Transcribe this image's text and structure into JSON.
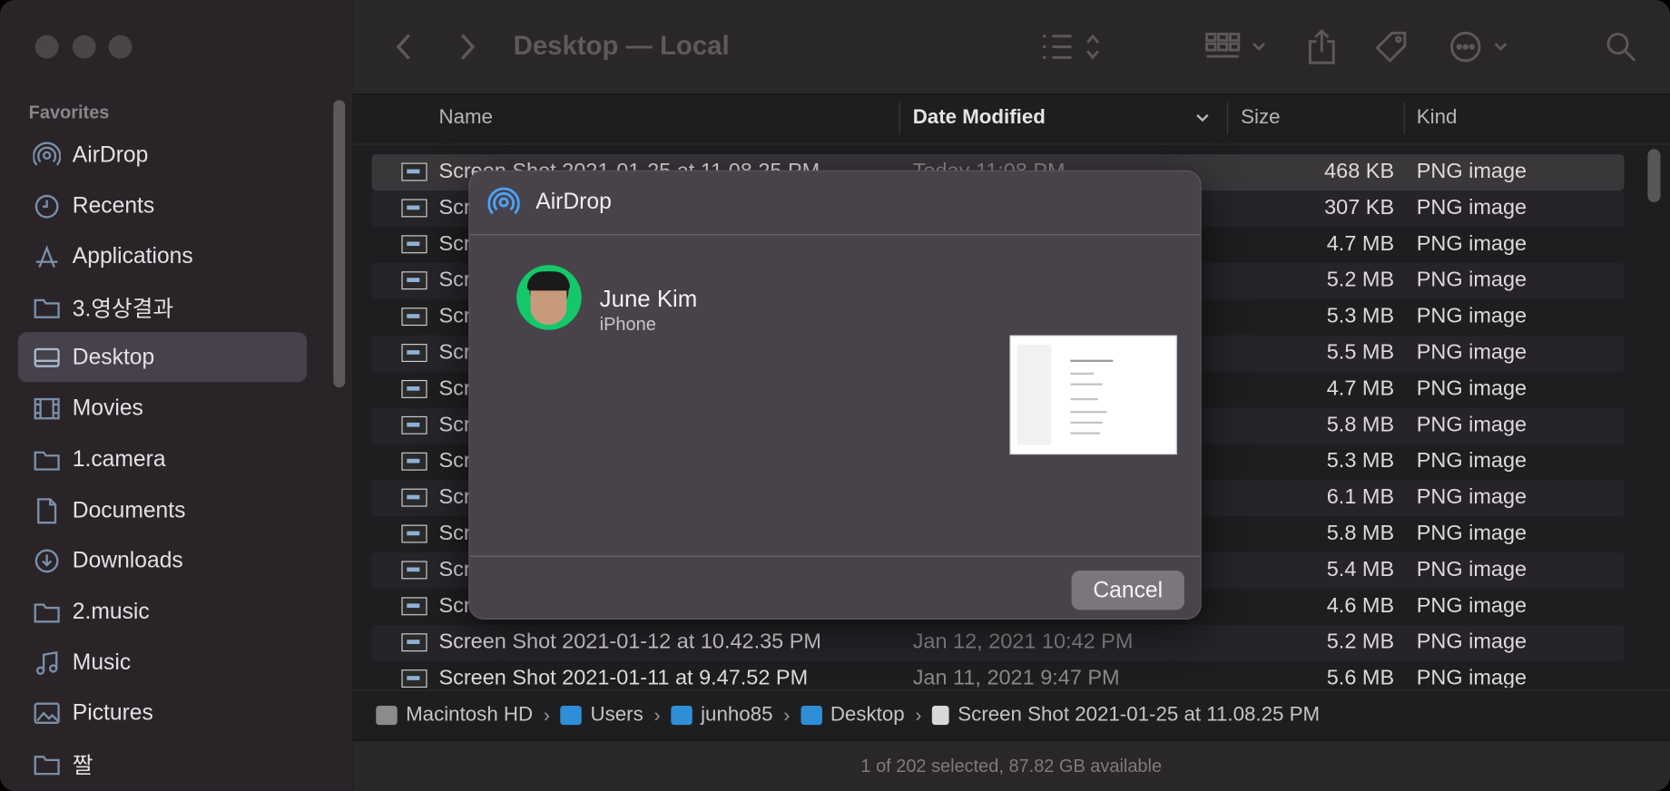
{
  "window": {
    "title": "Desktop — Local"
  },
  "sidebar": {
    "section_header": "Favorites",
    "items": [
      {
        "label": "AirDrop",
        "icon": "airdrop-icon"
      },
      {
        "label": "Recents",
        "icon": "clock-icon"
      },
      {
        "label": "Applications",
        "icon": "applications-icon"
      },
      {
        "label": "3.영상결과",
        "icon": "folder-icon"
      },
      {
        "label": "Desktop",
        "icon": "desktop-icon",
        "selected": true
      },
      {
        "label": "Movies",
        "icon": "film-icon"
      },
      {
        "label": "1.camera",
        "icon": "folder-icon"
      },
      {
        "label": "Documents",
        "icon": "document-icon"
      },
      {
        "label": "Downloads",
        "icon": "download-icon"
      },
      {
        "label": "2.music",
        "icon": "folder-icon"
      },
      {
        "label": "Music",
        "icon": "music-icon"
      },
      {
        "label": "Pictures",
        "icon": "pictures-icon"
      },
      {
        "label": "짤",
        "icon": "folder-icon"
      }
    ]
  },
  "columns": {
    "name": "Name",
    "date": "Date Modified",
    "size": "Size",
    "kind": "Kind"
  },
  "rows": [
    {
      "name": "Screen Shot 2021-01-25 at 11.08.25 PM",
      "date": "Today 11:08 PM",
      "size": "468 KB",
      "kind": "PNG image"
    },
    {
      "name": "Scr",
      "date": "",
      "size": "307 KB",
      "kind": "PNG image"
    },
    {
      "name": "Scr",
      "date": "",
      "size": "4.7 MB",
      "kind": "PNG image"
    },
    {
      "name": "Scr",
      "date": "",
      "size": "5.2 MB",
      "kind": "PNG image"
    },
    {
      "name": "Scr",
      "date": "",
      "size": "5.3 MB",
      "kind": "PNG image"
    },
    {
      "name": "Scr",
      "date": "",
      "size": "5.5 MB",
      "kind": "PNG image"
    },
    {
      "name": "Scr",
      "date": "",
      "size": "4.7 MB",
      "kind": "PNG image"
    },
    {
      "name": "Scr",
      "date": "",
      "size": "5.8 MB",
      "kind": "PNG image"
    },
    {
      "name": "Scr",
      "date": "",
      "size": "5.3 MB",
      "kind": "PNG image"
    },
    {
      "name": "Scr",
      "date": "",
      "size": "6.1 MB",
      "kind": "PNG image"
    },
    {
      "name": "Scr",
      "date": "",
      "size": "5.8 MB",
      "kind": "PNG image"
    },
    {
      "name": "Scr",
      "date": "",
      "size": "5.4 MB",
      "kind": "PNG image"
    },
    {
      "name": "Scr",
      "date": "",
      "size": "4.6 MB",
      "kind": "PNG image"
    },
    {
      "name": "Screen Shot 2021-01-12 at 10.42.35 PM",
      "date": "Jan 12, 2021 10:42 PM",
      "size": "5.2 MB",
      "kind": "PNG image"
    },
    {
      "name": "Screen Shot 2021-01-11 at 9.47.52 PM",
      "date": "Jan 11, 2021 9:47 PM",
      "size": "5.6 MB",
      "kind": "PNG image"
    }
  ],
  "path": {
    "crumbs": [
      "Macintosh HD",
      "Users",
      "junho85",
      "Desktop",
      "Screen Shot 2021-01-25 at 11.08.25 PM"
    ]
  },
  "status": {
    "text": "1 of 202 selected, 87.82 GB available"
  },
  "airdrop_sheet": {
    "title": "AirDrop",
    "contact_name": "June Kim",
    "contact_device": "iPhone",
    "cancel_label": "Cancel"
  },
  "colors": {
    "accent_airdrop": "#4aa3ff",
    "avatar_ring": "#14c86a"
  }
}
